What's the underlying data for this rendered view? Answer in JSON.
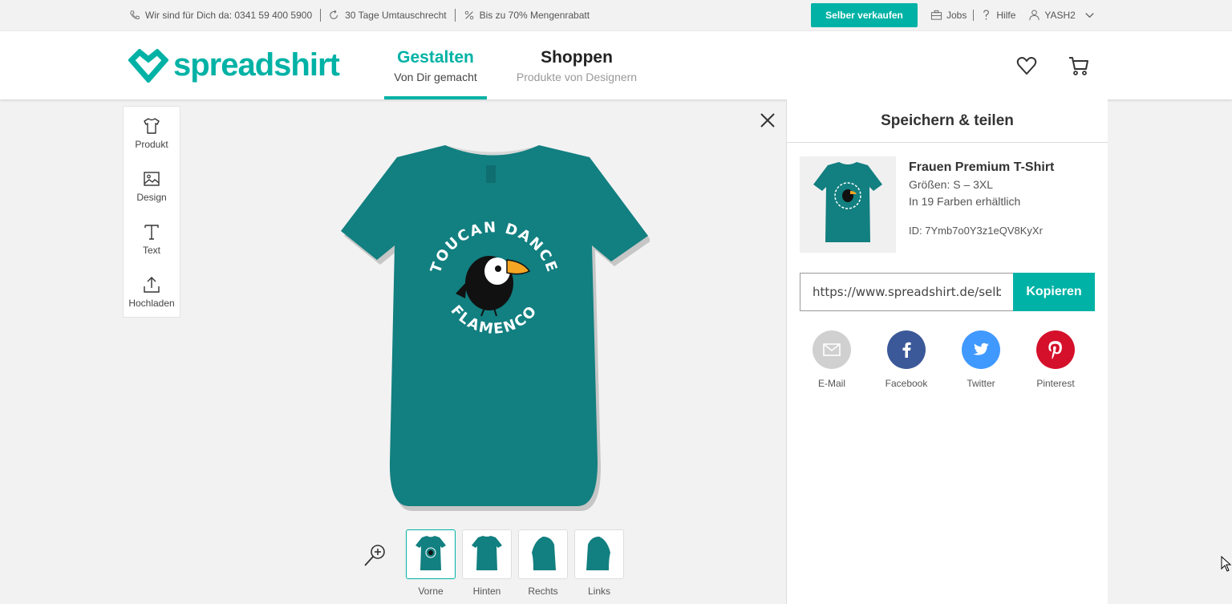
{
  "topbar": {
    "phone": "Wir sind für Dich da: 0341 59 400 5900",
    "exchange": "30 Tage Umtauschrecht",
    "discount": "Bis zu 70% Mengenrabatt",
    "sell_button": "Selber verkaufen",
    "jobs": "Jobs",
    "help": "Hilfe",
    "user": "YASH2"
  },
  "header": {
    "logo": "spreadshirt",
    "tabs": [
      {
        "title": "Gestalten",
        "sub": "Von Dir gemacht"
      },
      {
        "title": "Shoppen",
        "sub": "Produkte von Designern"
      }
    ]
  },
  "tools": [
    {
      "label": "Produkt",
      "icon": "tshirt-icon"
    },
    {
      "label": "Design",
      "icon": "image-icon"
    },
    {
      "label": "Text",
      "icon": "text-icon"
    },
    {
      "label": "Hochladen",
      "icon": "upload-icon"
    }
  ],
  "design": {
    "top_text": "TOUCAN DANCE",
    "bottom_text": "FLAMENCO"
  },
  "views": [
    "Vorne",
    "Hinten",
    "Rechts",
    "Links"
  ],
  "panel": {
    "title": "Speichern & teilen",
    "product_name": "Frauen Premium T-Shirt",
    "sizes": "Größen: S – 3XL",
    "colors": "In 19 Farben erhältlich",
    "id": "ID: 7Ymb7o0Y3z1eQV8KyXr",
    "url": "https://www.spreadshirt.de/selbst-gestalten",
    "copy_button": "Kopieren",
    "shares": [
      {
        "label": "E-Mail",
        "color": "#d0d0d0"
      },
      {
        "label": "Facebook",
        "color": "#3b5998"
      },
      {
        "label": "Twitter",
        "color": "#4099ff"
      },
      {
        "label": "Pinterest",
        "color": "#d5102b"
      }
    ]
  },
  "colors": {
    "accent": "#00b2a5",
    "shirt": "#127f80"
  }
}
